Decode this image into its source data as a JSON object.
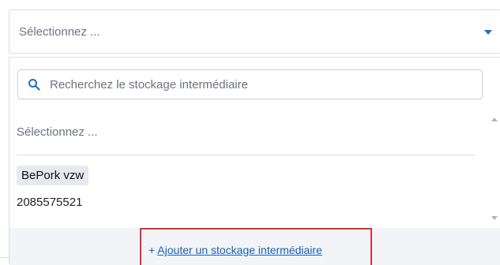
{
  "select": {
    "placeholder": "Sélectionnez ...",
    "caret_icon": "caret-down-icon",
    "accent_color": "#1a6fd0"
  },
  "dropdown": {
    "search": {
      "placeholder": "Recherchez le stockage intermédiaire",
      "value": "",
      "icon": "search-icon"
    },
    "options_placeholder": "Sélectionnez ...",
    "options": [
      {
        "name": "BePork vzw",
        "number": "2085575521"
      }
    ],
    "footer": {
      "add_prefix": "+ ",
      "add_label": "Ajouter un stockage intermédiaire",
      "highlight_color": "#d9313a"
    }
  }
}
